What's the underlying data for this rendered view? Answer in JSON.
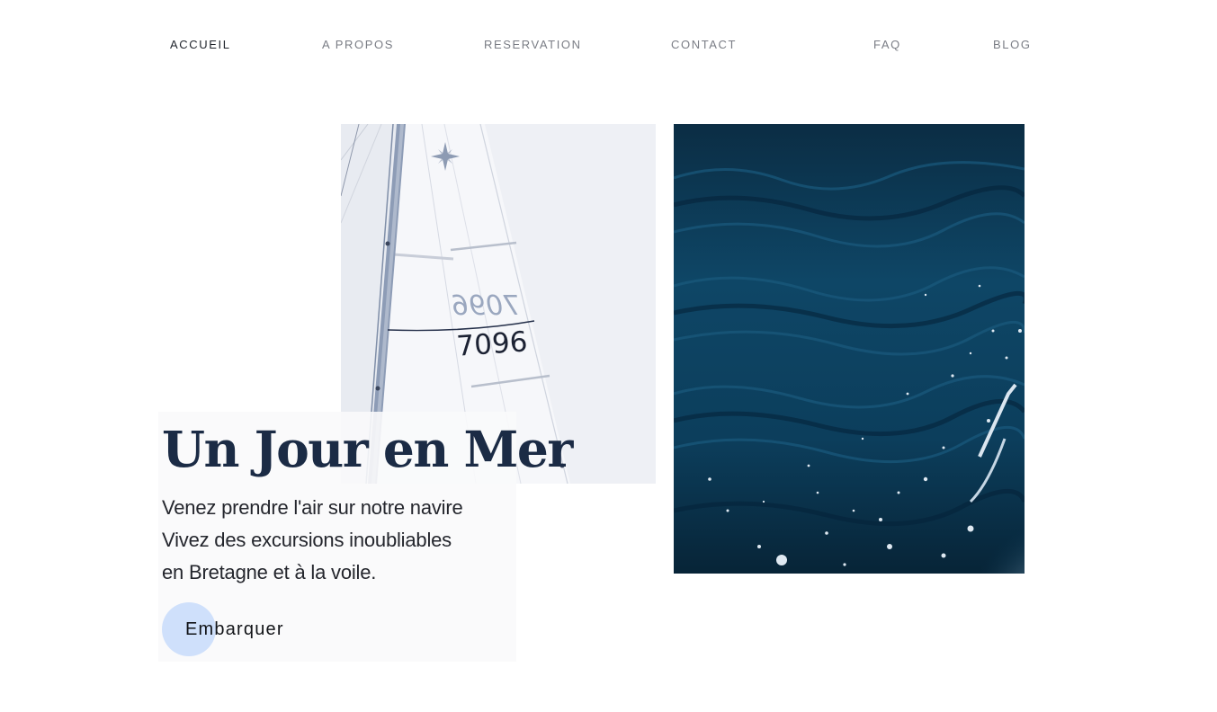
{
  "nav": {
    "items": [
      {
        "label": "ACCUEIL",
        "active": true
      },
      {
        "label": "A PROPOS",
        "active": false
      },
      {
        "label": "RESERVATION",
        "active": false
      },
      {
        "label": "CONTACT",
        "active": false
      },
      {
        "label": "FAQ",
        "active": false
      },
      {
        "label": "BLOG",
        "active": false
      }
    ]
  },
  "sail_image": {
    "sail_number": "7096",
    "sail_number_mirrored": "7096"
  },
  "hero": {
    "title": "Un Jour en Mer",
    "lines": [
      "Venez prendre l'air sur notre navire",
      "Vivez des excursions inoubliables",
      "en Bretagne et à la voile."
    ],
    "cta_label": "Embarquer"
  },
  "colors": {
    "title": "#1b2b45",
    "cta_circle": "#cfe0fb",
    "nav_active": "#1f232b",
    "nav_inactive": "#7a7d85",
    "sea": "#0b3550"
  }
}
